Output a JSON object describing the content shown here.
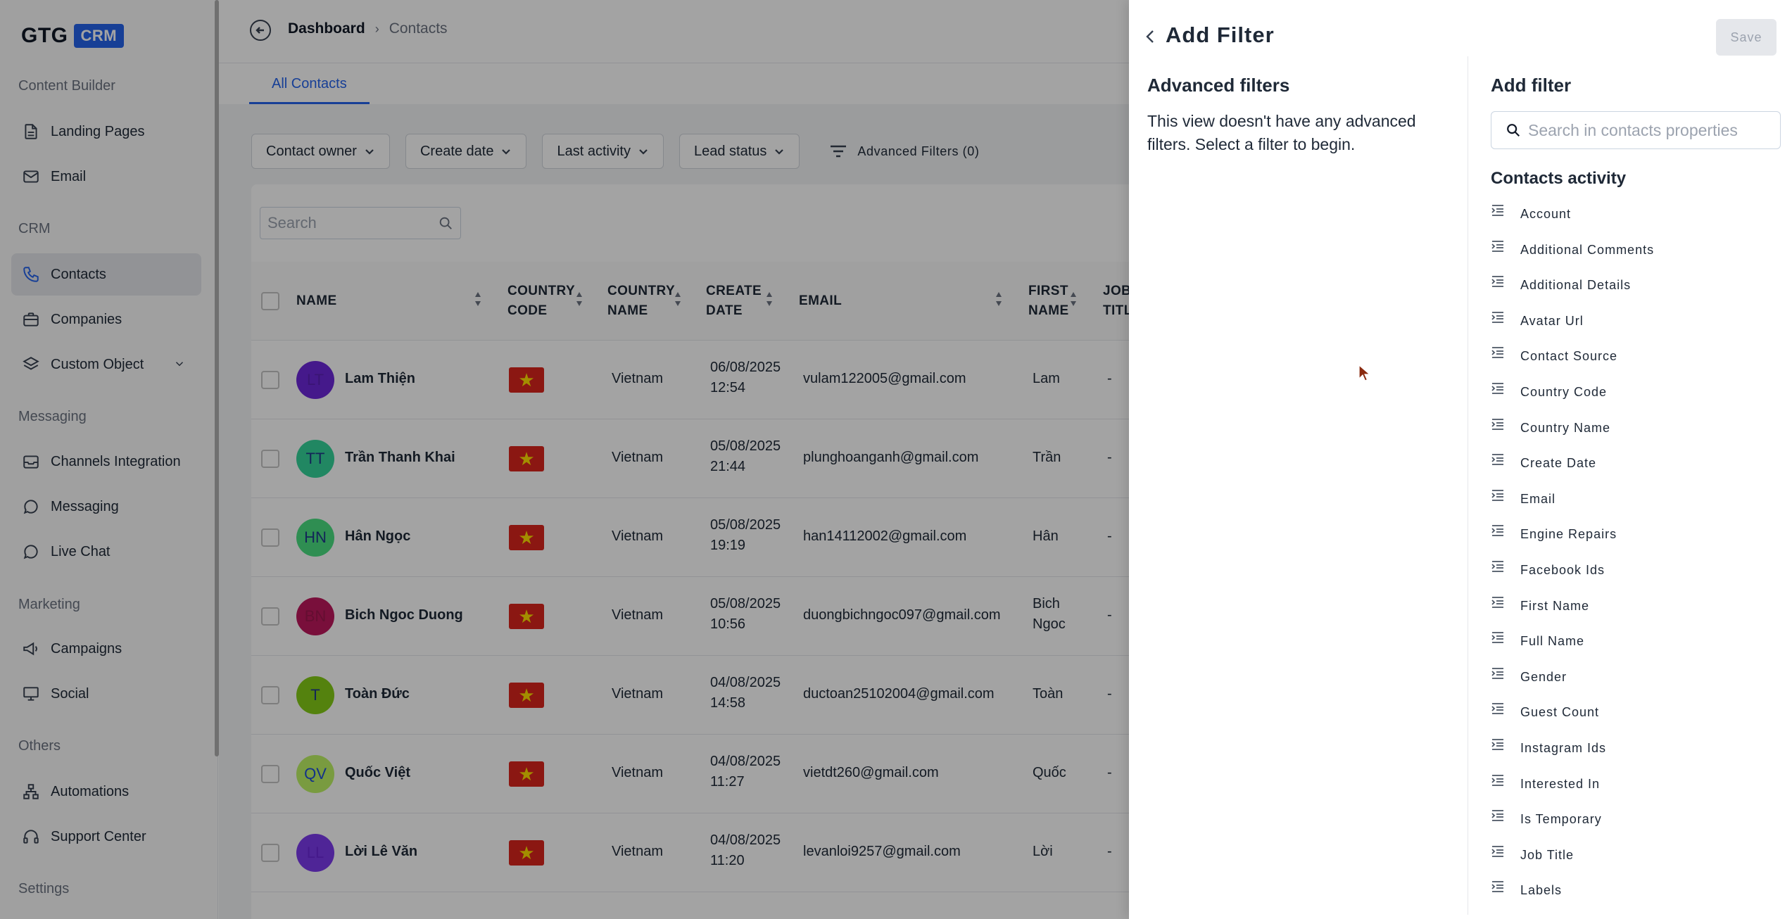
{
  "logo": {
    "text": "GTG",
    "badge": "CRM"
  },
  "sidebar": {
    "sections": [
      {
        "title": "Content Builder"
      },
      {
        "title": "CRM"
      },
      {
        "title": "Messaging"
      },
      {
        "title": "Marketing"
      },
      {
        "title": "Others"
      },
      {
        "title": "Settings"
      }
    ],
    "items": [
      {
        "label": "Landing Pages",
        "icon": "file-icon"
      },
      {
        "label": "Email",
        "icon": "mail-icon"
      },
      {
        "label": "Contacts",
        "icon": "phone-icon",
        "active": true
      },
      {
        "label": "Companies",
        "icon": "briefcase-icon"
      },
      {
        "label": "Custom Object",
        "icon": "layers-icon"
      },
      {
        "label": "Channels Integration",
        "icon": "inbox-icon"
      },
      {
        "label": "Messaging",
        "icon": "chat-bubble-icon"
      },
      {
        "label": "Live Chat",
        "icon": "live-chat-icon"
      },
      {
        "label": "Campaigns",
        "icon": "megaphone-icon"
      },
      {
        "label": "Social",
        "icon": "monitor-icon"
      },
      {
        "label": "Automations",
        "icon": "workflow-icon"
      },
      {
        "label": "Support Center",
        "icon": "headset-icon"
      }
    ]
  },
  "header": {
    "breadcrumb_root": "Dashboard",
    "breadcrumb_current": "Contacts"
  },
  "tabs": [
    {
      "label": "All Contacts"
    }
  ],
  "filters": {
    "contact_owner": "Contact owner",
    "create_date": "Create date",
    "last_activity": "Last activity",
    "lead_status": "Lead status",
    "advanced": "Advanced Filters (0)"
  },
  "table": {
    "search_placeholder": "Search",
    "columns": {
      "name": "NAME",
      "country_code_1": "COUNTRY",
      "country_code_2": "CODE",
      "country_name_1": "COUNTRY",
      "country_name_2": "NAME",
      "create_date_1": "CREATE",
      "create_date_2": "DATE",
      "email": "EMAIL",
      "first_name_1": "FIRST",
      "first_name_2": "NAME",
      "job_title_1": "JOB",
      "job_title_2": "TITL"
    },
    "rows": [
      {
        "initials": "LT",
        "name": "Lam Thiện",
        "country": "Vietnam",
        "date": "06/08/2025",
        "time": "12:54",
        "email": "vulam122005@gmail.com",
        "first": "Lam",
        "first2": "",
        "job": "-",
        "avatar_bg": "#6d28d9",
        "avatar_fg": "#5b21b6"
      },
      {
        "initials": "TT",
        "name": "Trần Thanh Khai",
        "country": "Vietnam",
        "date": "05/08/2025",
        "time": "21:44",
        "email": "plunghoanganh@gmail.com",
        "first": "Trần",
        "first2": "",
        "job": "-",
        "avatar_bg": "#34d399",
        "avatar_fg": "#1e3a8a"
      },
      {
        "initials": "HN",
        "name": "Hân Ngọc",
        "country": "Vietnam",
        "date": "05/08/2025",
        "time": "19:19",
        "email": "han14112002@gmail.com",
        "first": "Hân",
        "first2": "",
        "job": "-",
        "avatar_bg": "#4ade80",
        "avatar_fg": "#1e3a8a"
      },
      {
        "initials": "BN",
        "name": "Bich Ngoc Duong",
        "country": "Vietnam",
        "date": "05/08/2025",
        "time": "10:56",
        "email": "duongbichngoc097@gmail.com",
        "first": "Bich",
        "first2": "Ngoc",
        "job": "-",
        "avatar_bg": "#be185d",
        "avatar_fg": "#9d174d"
      },
      {
        "initials": "T",
        "name": "Toàn Đức",
        "country": "Vietnam",
        "date": "04/08/2025",
        "time": "14:58",
        "email": "ductoan25102004@gmail.com",
        "first": "Toàn",
        "first2": "",
        "job": "-",
        "avatar_bg": "#84cc16",
        "avatar_fg": "#1e3a8a"
      },
      {
        "initials": "QV",
        "name": "Quốc Việt",
        "country": "Vietnam",
        "date": "04/08/2025",
        "time": "11:27",
        "email": "vietdt260@gmail.com",
        "first": "Quốc",
        "first2": "",
        "job": "-",
        "avatar_bg": "#bef264",
        "avatar_fg": "#1d4ed8"
      },
      {
        "initials": "LL",
        "name": "Lời Lê Văn",
        "country": "Vietnam",
        "date": "04/08/2025",
        "time": "11:20",
        "email": "levanloi9257@gmail.com",
        "first": "Lời",
        "first2": "",
        "job": "-",
        "avatar_bg": "#7c3aed",
        "avatar_fg": "#6d28d9"
      }
    ]
  },
  "drawer": {
    "title": "Add Filter",
    "save_label": "Save",
    "left_heading": "Advanced filters",
    "left_text": "This view doesn't have any advanced filters. Select a filter to begin.",
    "right_heading": "Add filter",
    "search_placeholder": "Search in contacts properties",
    "group_title": "Contacts activity",
    "properties": [
      "Account",
      "Additional Comments",
      "Additional Details",
      "Avatar Url",
      "Contact Source",
      "Country Code",
      "Country Name",
      "Create Date",
      "Email",
      "Engine Repairs",
      "Facebook Ids",
      "First Name",
      "Full Name",
      "Gender",
      "Guest Count",
      "Instagram Ids",
      "Interested In",
      "Is Temporary",
      "Job Title",
      "Labels"
    ]
  }
}
